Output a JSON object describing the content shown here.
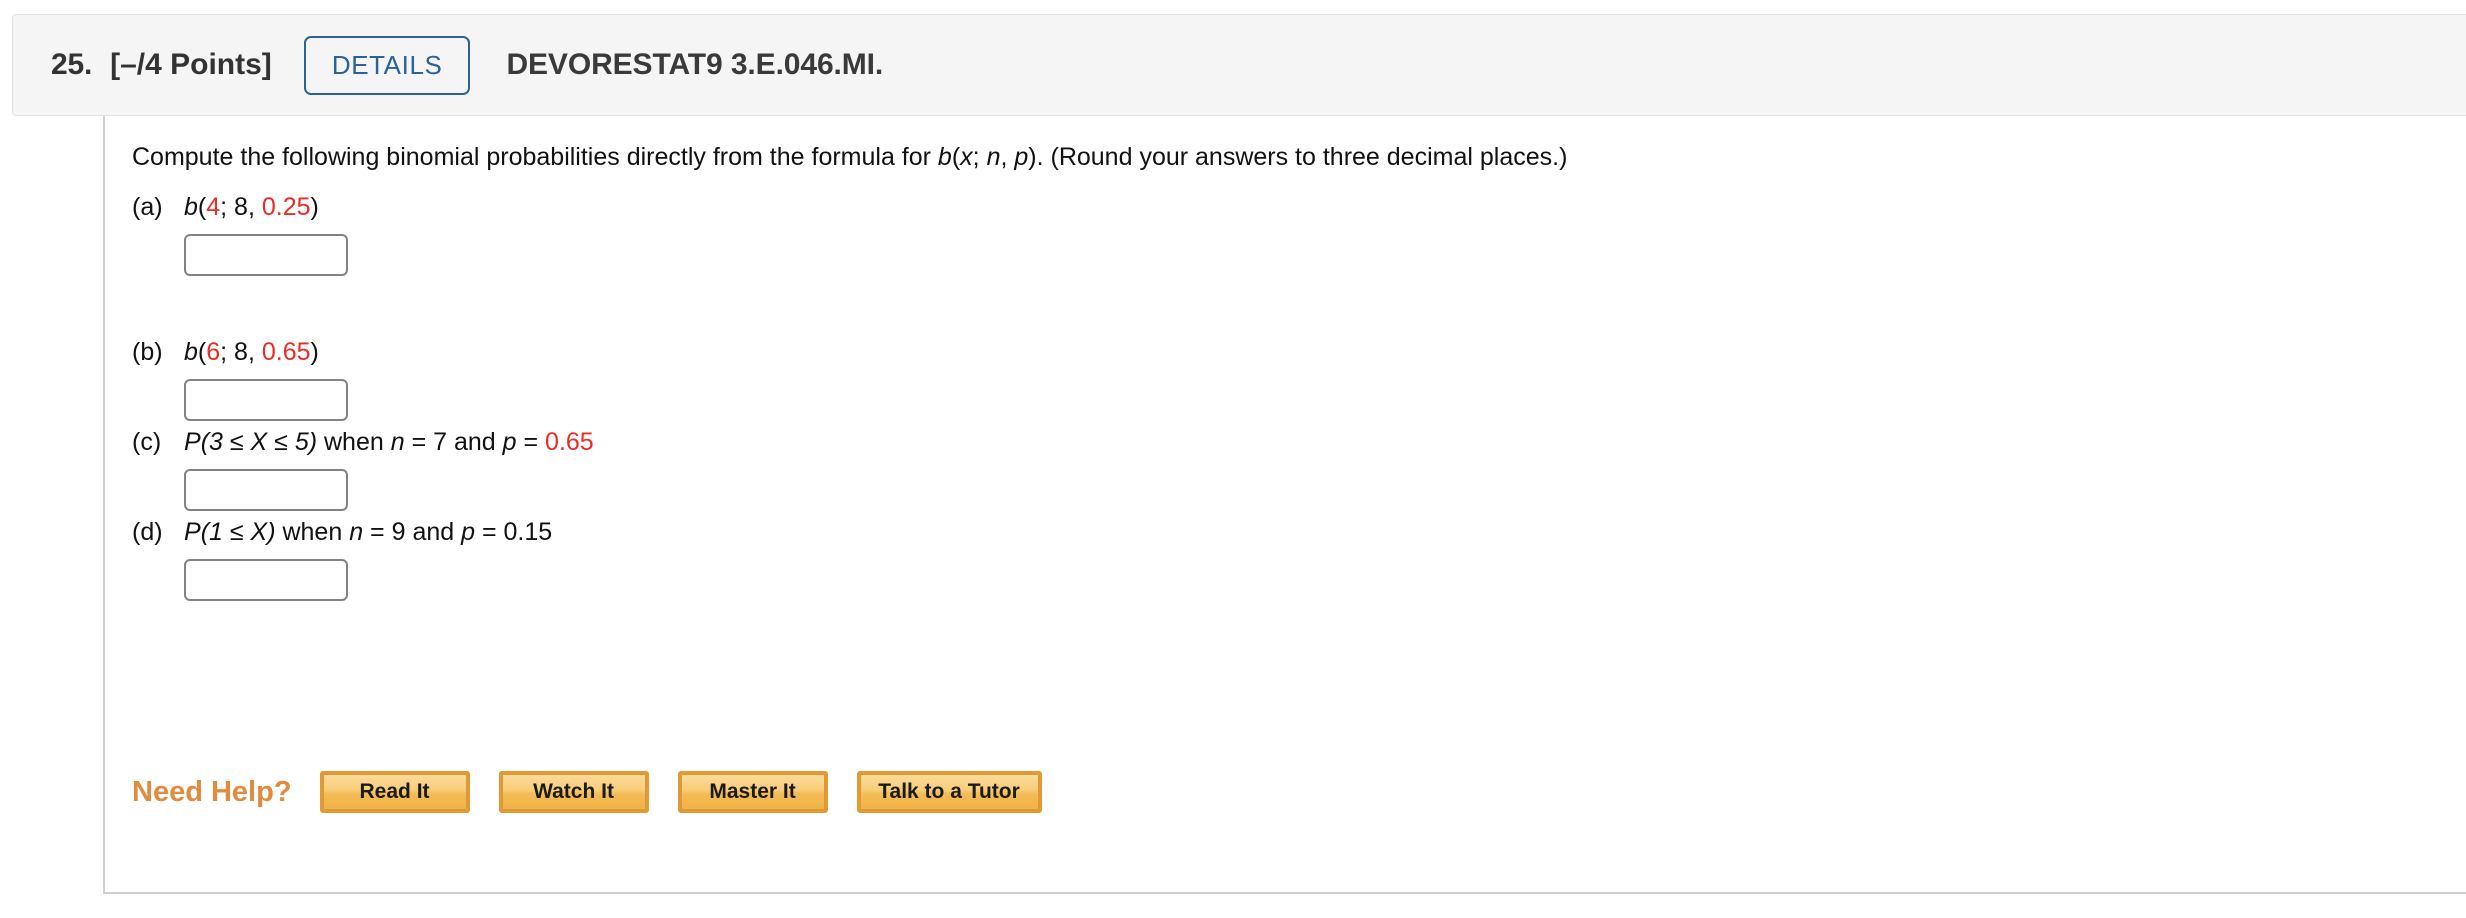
{
  "header": {
    "problem_number": "25.",
    "points": "[–/4 Points]",
    "details_label": "DETAILS",
    "assignment_code": "DEVORESTAT9 3.E.046.MI.",
    "accent_blue": "#2b6298",
    "background": "#f5f5f5"
  },
  "question": {
    "prompt_part1": "Compute the following binomial probabilities directly from the formula for ",
    "prompt_b": "b",
    "prompt_paren_open": "(",
    "prompt_x": "x",
    "prompt_semicolon": "; ",
    "prompt_n": "n",
    "prompt_comma": ", ",
    "prompt_p": "p",
    "prompt_part2": "). (Round your answers to three decimal places.)"
  },
  "parts": [
    {
      "letter": "(a)",
      "func": "b",
      "open": "(",
      "x": "4",
      "x_red": true,
      "sep1": "; ",
      "n": "8",
      "n_red": false,
      "sep2": ", ",
      "p": "0.25",
      "p_red": true,
      "close": ")",
      "answer_value": "",
      "answer_placeholder": ""
    },
    {
      "letter": "(b)",
      "func": "b",
      "open": "(",
      "x": "6",
      "x_red": true,
      "sep1": "; ",
      "n": "8",
      "n_red": false,
      "sep2": ", ",
      "p": "0.65",
      "p_red": true,
      "close": ")",
      "answer_value": "",
      "answer_placeholder": ""
    },
    {
      "letter": "(c)",
      "expr_prefix": "P",
      "expr_body": "(3 ≤ X ≤ 5)",
      "when": " when ",
      "n_symbol": "n",
      "n_eq": " = ",
      "n_value": "7",
      "and": " and ",
      "p_symbol": "p",
      "p_eq": " = ",
      "p_value": "0.65",
      "p_red": true,
      "answer_value": "",
      "answer_placeholder": ""
    },
    {
      "letter": "(d)",
      "expr_prefix": "P",
      "expr_body": "(1 ≤ X)",
      "when": " when ",
      "n_symbol": "n",
      "n_eq": " = ",
      "n_value": "9",
      "and": " and ",
      "p_symbol": "p",
      "p_eq": " = ",
      "p_value": "0.15",
      "p_red": false,
      "answer_value": "",
      "answer_placeholder": ""
    }
  ],
  "need_help": {
    "label": "Need Help?",
    "label_color": "#e08b3d",
    "buttons": [
      {
        "label": "Read It"
      },
      {
        "label": "Watch It"
      },
      {
        "label": "Master It"
      },
      {
        "label": "Talk to a Tutor"
      }
    ]
  }
}
